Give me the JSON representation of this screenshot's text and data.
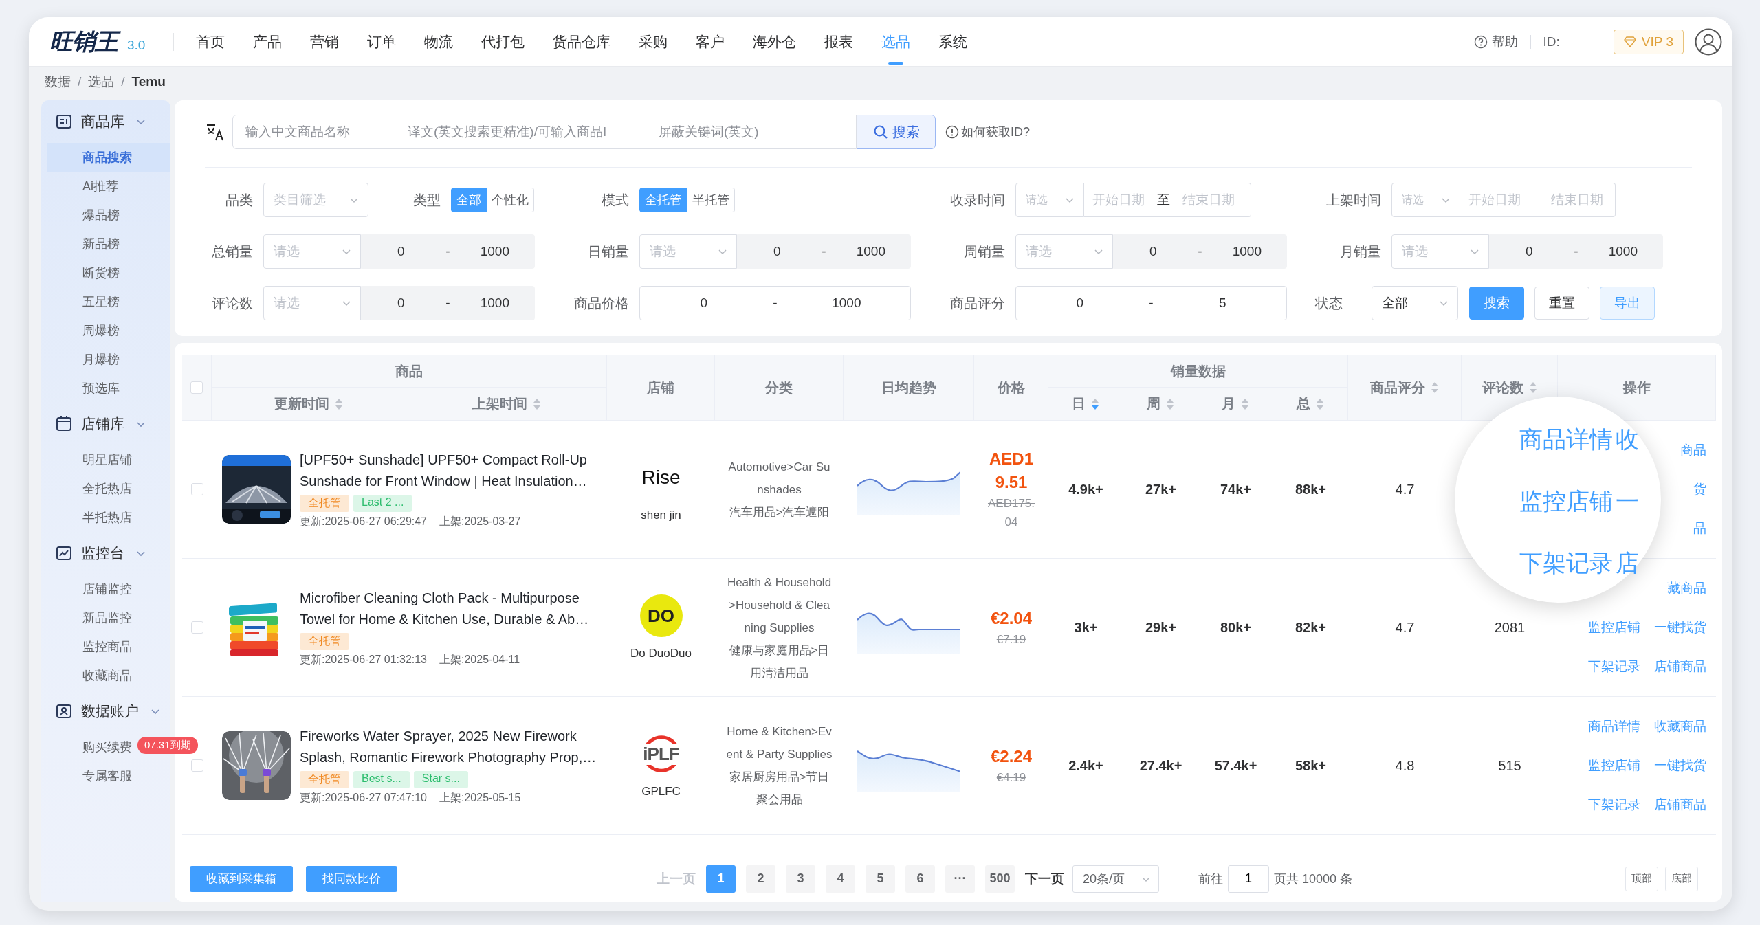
{
  "app": {
    "logo": {
      "name": "旺销王",
      "version": "3.0"
    },
    "nav": [
      {
        "label": "首页",
        "selected": false
      },
      {
        "label": "产品",
        "selected": false
      },
      {
        "label": "营销",
        "selected": false
      },
      {
        "label": "订单",
        "selected": false
      },
      {
        "label": "物流",
        "selected": false
      },
      {
        "label": "代打包",
        "selected": false
      },
      {
        "label": "货品仓库",
        "selected": false
      },
      {
        "label": "采购",
        "selected": false
      },
      {
        "label": "客户",
        "selected": false
      },
      {
        "label": "海外仓",
        "selected": false
      },
      {
        "label": "报表",
        "selected": false
      },
      {
        "label": "选品",
        "selected": true
      },
      {
        "label": "系统",
        "selected": false
      }
    ],
    "help": "帮助",
    "id_label": "ID:",
    "vip": "VIP 3"
  },
  "breadcrumb": {
    "items": [
      "数据",
      "选品",
      "Temu"
    ],
    "separator": "/"
  },
  "sidebar": {
    "groups": [
      {
        "label": "商品库",
        "expanded": true,
        "items": [
          {
            "label": "商品搜索",
            "selected": true
          },
          {
            "label": "Ai推荐",
            "selected": false
          },
          {
            "label": "爆品榜",
            "selected": false
          },
          {
            "label": "新品榜",
            "selected": false
          },
          {
            "label": "断货榜",
            "selected": false
          },
          {
            "label": "五星榜",
            "selected": false
          },
          {
            "label": "周爆榜",
            "selected": false
          },
          {
            "label": "月爆榜",
            "selected": false
          },
          {
            "label": "预选库",
            "selected": false
          }
        ]
      },
      {
        "label": "店铺库",
        "expanded": true,
        "items": [
          {
            "label": "明星店铺",
            "selected": false
          },
          {
            "label": "全托热店",
            "selected": false
          },
          {
            "label": "半托热店",
            "selected": false
          }
        ]
      },
      {
        "label": "监控台",
        "expanded": true,
        "items": [
          {
            "label": "店铺监控",
            "selected": false
          },
          {
            "label": "新品监控",
            "selected": false
          },
          {
            "label": "监控商品",
            "selected": false
          },
          {
            "label": "收藏商品",
            "selected": false
          }
        ]
      },
      {
        "label": "数据账户",
        "expanded": true,
        "items": [
          {
            "label": "购买续费",
            "selected": false,
            "badge": "07.31到期"
          },
          {
            "label": "专属客服",
            "selected": false
          }
        ]
      }
    ]
  },
  "search": {
    "fields": [
      {
        "placeholder": "输入中文商品名称"
      },
      {
        "placeholder": "译文(英文搜索更精准)/可输入商品I"
      },
      {
        "placeholder": "屏蔽关键词(英文)"
      }
    ],
    "button": "搜索",
    "help_link": "如何获取ID?"
  },
  "filters": {
    "rows": [
      [
        [
          {
            "kind": "select",
            "label": "品类",
            "placeholder": "类目筛选"
          },
          {
            "kind": "toggle",
            "label": "类型",
            "options": [
              {
                "label": "全部",
                "selected": true
              },
              {
                "label": "个性化",
                "selected": false
              }
            ]
          }
        ],
        [
          {
            "kind": "toggle",
            "label": "模式",
            "options": [
              {
                "label": "全托管",
                "selected": true
              },
              {
                "label": "半托管",
                "selected": false
              }
            ]
          }
        ],
        [
          {
            "kind": "select_date",
            "label": "收录时间",
            "select_placeholder": "请选",
            "start_placeholder": "开始日期",
            "separator": "至",
            "end_placeholder": "结束日期"
          }
        ],
        [
          {
            "kind": "select_date",
            "label": "上架时间",
            "select_placeholder": "请选",
            "start_placeholder": "开始日期",
            "end_placeholder": "结束日期"
          }
        ]
      ],
      [
        [
          {
            "kind": "select_range",
            "label": "总销量",
            "select_placeholder": "请选",
            "min": "0",
            "separator": "-",
            "max": "1000",
            "disabled": true
          }
        ],
        [
          {
            "kind": "select_range",
            "label": "日销量",
            "select_placeholder": "请选",
            "min": "0",
            "separator": "-",
            "max": "1000",
            "disabled": true
          }
        ],
        [
          {
            "kind": "select_range",
            "label": "周销量",
            "select_placeholder": "请选",
            "min": "0",
            "separator": "-",
            "max": "1000",
            "disabled": true
          }
        ],
        [
          {
            "kind": "select_range",
            "label": "月销量",
            "select_placeholder": "请选",
            "min": "0",
            "separator": "-",
            "max": "1000",
            "disabled": true
          }
        ]
      ],
      [
        [
          {
            "kind": "select_range",
            "label": "评论数",
            "select_placeholder": "请选",
            "min": "0",
            "separator": "-",
            "max": "1000",
            "disabled": true
          }
        ],
        [
          {
            "kind": "range",
            "label": "商品价格",
            "min": "0",
            "separator": "-",
            "max": "1000",
            "disabled": false
          }
        ],
        [
          {
            "kind": "range",
            "label": "商品评分",
            "min": "0",
            "separator": "-",
            "max": "5",
            "disabled": false
          }
        ],
        [
          {
            "kind": "select",
            "label": "状态",
            "value": "全部"
          },
          {
            "kind": "buttons",
            "buttons": [
              {
                "label": "搜索",
                "kind": "primary"
              },
              {
                "label": "重置",
                "kind": "plain"
              },
              {
                "label": "导出",
                "kind": "light"
              }
            ]
          }
        ]
      ]
    ]
  },
  "table": {
    "header_checkbox": {
      "checked": false
    },
    "columns": [
      {
        "label": "商品",
        "children": [
          {
            "label": "更新时间",
            "sorted": false
          },
          {
            "label": "上架时间",
            "sorted": false
          }
        ]
      },
      {
        "label": "店铺"
      },
      {
        "label": "分类"
      },
      {
        "label": "日均趋势"
      },
      {
        "label": "价格"
      },
      {
        "label": "销量数据",
        "children": [
          {
            "label": "日",
            "sorted": true
          },
          {
            "label": "周",
            "sorted": false
          },
          {
            "label": "月",
            "sorted": false
          },
          {
            "label": "总",
            "sorted": false
          }
        ]
      },
      {
        "label": "商品评分",
        "sorted": false
      },
      {
        "label": "评论数",
        "sorted": false
      },
      {
        "label": "操作"
      }
    ],
    "rows": [
      {
        "checked": false,
        "title": "[UPF50+ Sunshade] UPF50+ Compact Roll-Up Sunshade for Front Window | Heat Insulation…",
        "tags": [
          {
            "label": "全托管",
            "kind": "mode"
          },
          {
            "label": "Last 2 ...",
            "kind": "label"
          }
        ],
        "updated": "更新:2025-06-27 06:29:47",
        "listed": "上架:2025-03-27",
        "store": {
          "logo": "Rise",
          "kind": "wordmark",
          "name": "shen jin"
        },
        "category": [
          "Automotive>Car Sunshades",
          "汽车用品>汽车遮阳"
        ],
        "trend": {
          "kind": "rise"
        },
        "price": "AED19.51",
        "original_price": "AED175.04",
        "sales": [
          "4.9k+",
          "27k+",
          "74k+",
          "88k+"
        ],
        "rating": "4.7",
        "actions": [
          [
            "商品"
          ],
          [
            "货"
          ],
          [
            "品"
          ]
        ]
      },
      {
        "checked": false,
        "title": "Microfiber Cleaning Cloth Pack - Multipurpose Towel for Home & Kitchen Use, Durable & Ab…",
        "tags": [
          {
            "label": "全托管",
            "kind": "mode"
          }
        ],
        "updated": "更新:2025-06-27 01:32:13",
        "listed": "上架:2025-04-11",
        "store": {
          "logo": "DO",
          "kind": "circle",
          "name": "Do DuoDuo"
        },
        "category": [
          "Health & Household>Household & Cleaning Supplies",
          "健康与家庭用品>日用清洁用品"
        ],
        "trend": {
          "kind": "drop"
        },
        "price": "€2.04",
        "original_price": "€7.19",
        "sales": [
          "3k+",
          "29k+",
          "80k+",
          "82k+"
        ],
        "rating": "4.7",
        "reviews": "2081",
        "actions": [
          [
            "藏商品"
          ],
          [
            "监控店铺",
            "一键找货"
          ],
          [
            "下架记录",
            "店铺商品"
          ]
        ]
      },
      {
        "checked": false,
        "title": "Fireworks Water Sprayer, 2025 New Firework Splash, Romantic Firework Photography Prop,…",
        "tags": [
          {
            "label": "全托管",
            "kind": "mode"
          },
          {
            "label": "Best s...",
            "kind": "label"
          },
          {
            "label": "Star s...",
            "kind": "label"
          }
        ],
        "updated": "更新:2025-06-27 07:47:10",
        "listed": "上架:2025-05-15",
        "store": {
          "logo": "iPLF",
          "kind": "ring",
          "name": "GPLFC"
        },
        "category": [
          "Home & Kitchen>Event & Party Supplies",
          "家居厨房用品>节日聚会用品"
        ],
        "trend": {
          "kind": "fall"
        },
        "price": "€2.24",
        "original_price": "€4.19",
        "sales": [
          "2.4k+",
          "27.4k+",
          "57.4k+",
          "58k+"
        ],
        "rating": "4.8",
        "reviews": "515",
        "actions": [
          [
            "商品详情",
            "收藏商品"
          ],
          [
            "监控店铺",
            "一键找货"
          ],
          [
            "下架记录",
            "店铺商品"
          ]
        ]
      }
    ]
  },
  "magnifier": {
    "items": [
      "商品详情",
      "收",
      "监控店铺",
      "一",
      "下架记录",
      "店"
    ]
  },
  "pager": {
    "buttons": [
      "收藏到采集箱",
      "找同款比价"
    ],
    "prev": {
      "label": "上一页",
      "disabled": true
    },
    "pages": [
      {
        "label": "1",
        "selected": true
      },
      {
        "label": "2",
        "selected": false
      },
      {
        "label": "3",
        "selected": false
      },
      {
        "label": "4",
        "selected": false
      },
      {
        "label": "5",
        "selected": false
      },
      {
        "label": "6",
        "selected": false
      },
      {
        "label": "···",
        "selected": false
      },
      {
        "label": "500",
        "selected": false
      }
    ],
    "next": {
      "label": "下一页",
      "disabled": false
    },
    "page_size": "20条/页",
    "goto_label": "前往",
    "goto_value": "1",
    "total": "页共 10000 条",
    "scroll_buttons": [
      "顶部",
      "底部"
    ]
  }
}
